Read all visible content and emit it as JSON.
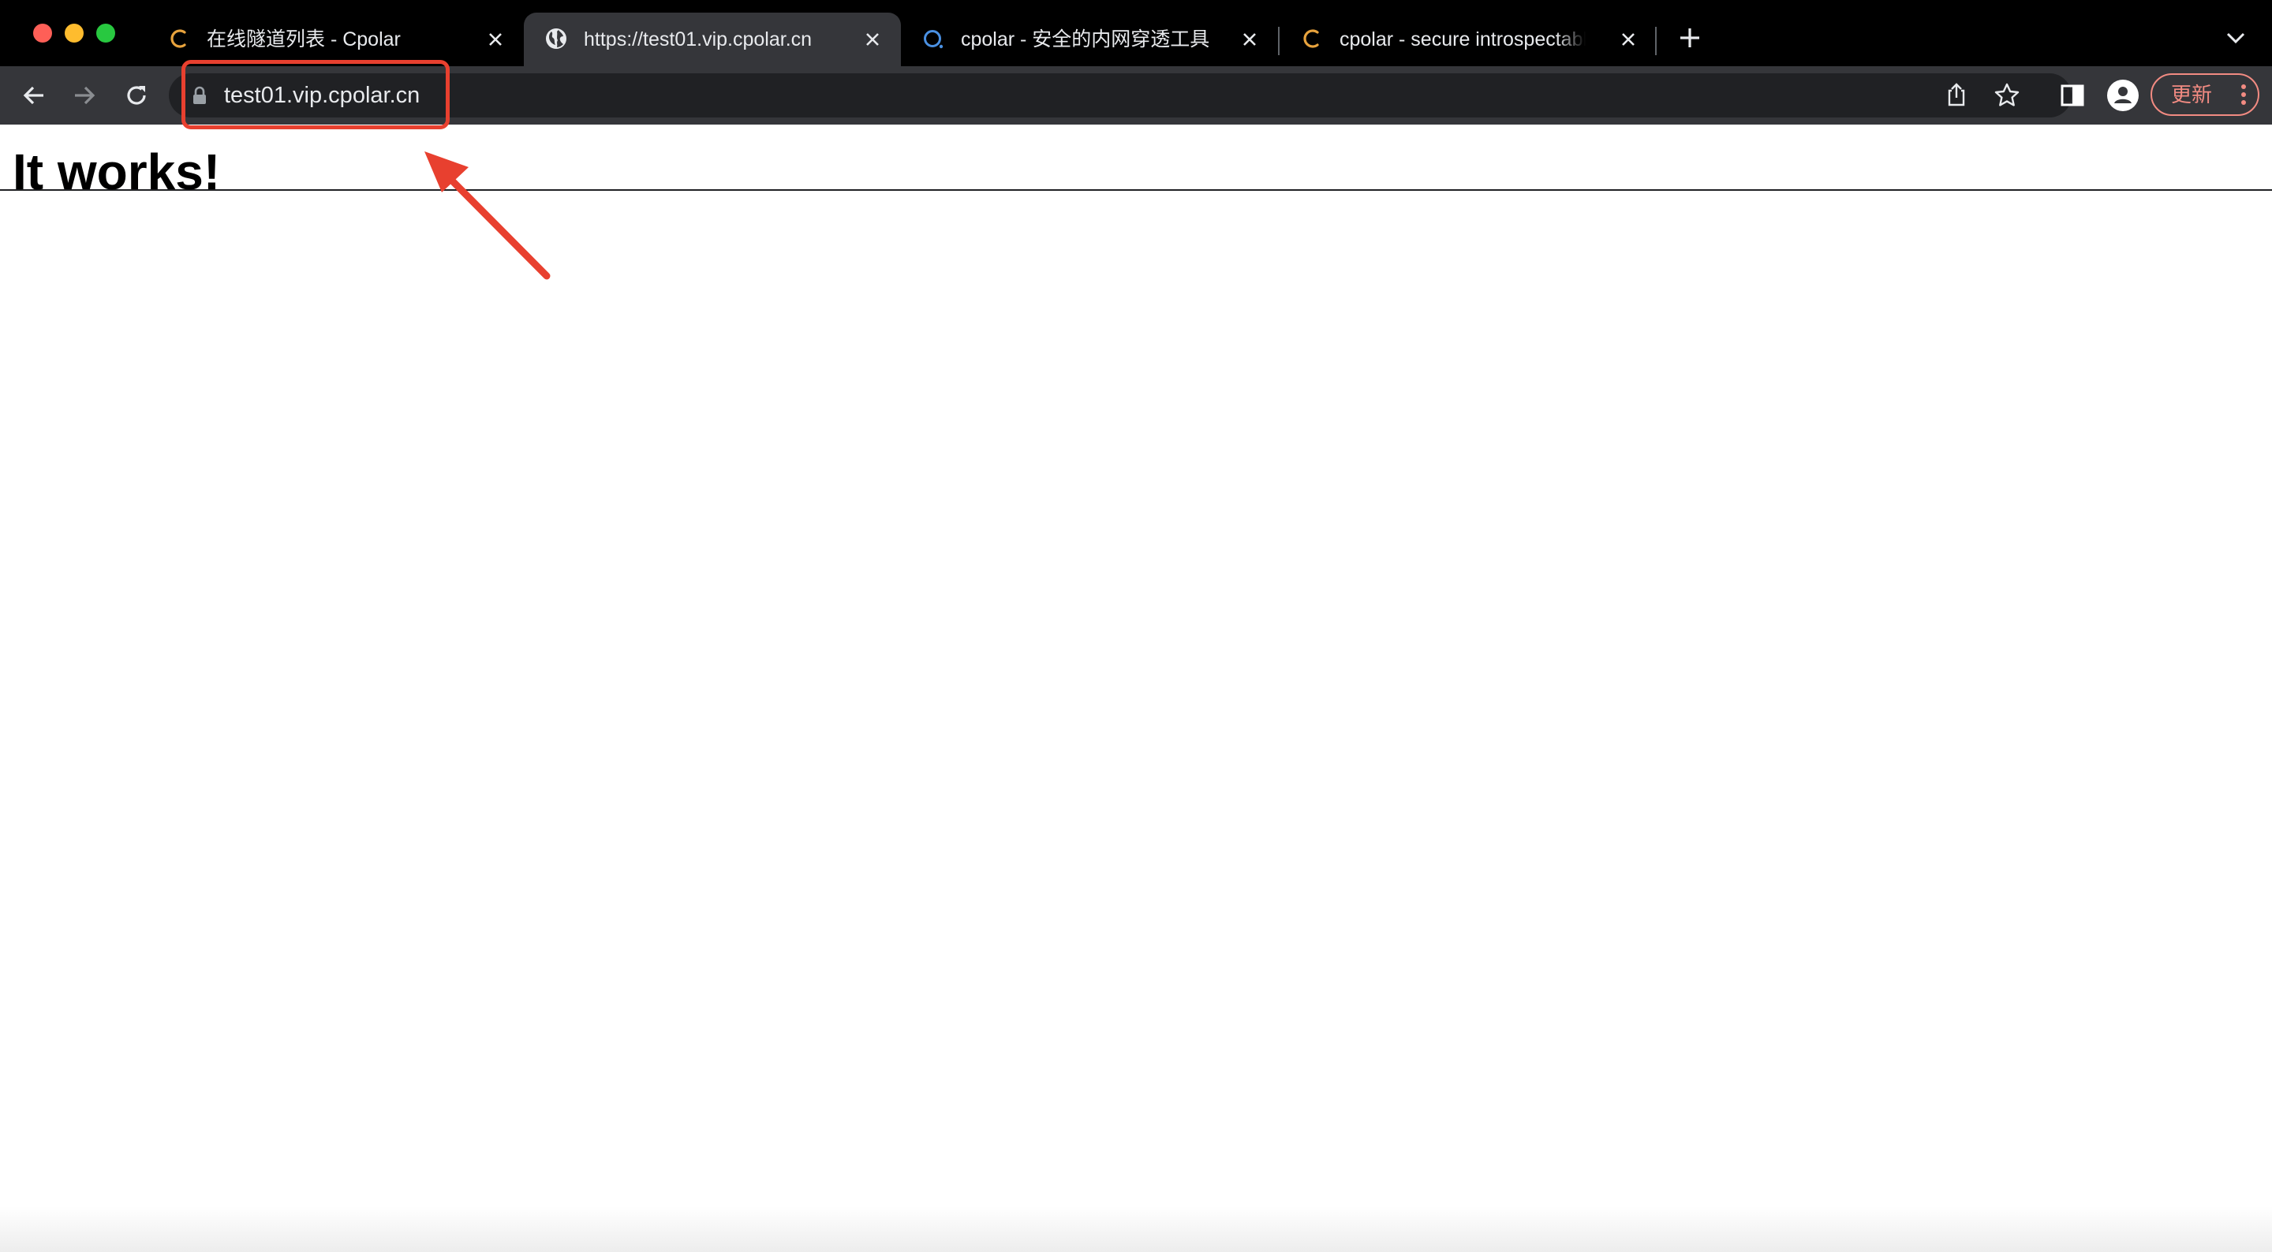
{
  "browser": {
    "tabs": [
      {
        "title": "在线隧道列表 - Cpolar",
        "favicon": "cpolar-c-icon",
        "active": false
      },
      {
        "title": "https://test01.vip.cpolar.cn",
        "favicon": "globe-icon",
        "active": true
      },
      {
        "title": "cpolar - 安全的内网穿透工具",
        "favicon": "cpolar-q-icon",
        "active": false
      },
      {
        "title": "cpolar - secure introspectable tunnels",
        "favicon": "cpolar-c-icon",
        "active": false
      }
    ],
    "address_bar": {
      "url": "test01.vip.cpolar.cn",
      "secure": true
    },
    "update_button": {
      "label": "更新"
    }
  },
  "page": {
    "heading": "It works!"
  },
  "annotation": {
    "color": "#e8402f",
    "target": "address-bar-url"
  },
  "colors": {
    "tab_strip": "#000000",
    "toolbar": "#35363a",
    "omnibox": "#202124",
    "update_accent": "#f28b82",
    "cpolar_orange": "#e8a33d",
    "cpolar_blue": "#4a90e2"
  }
}
